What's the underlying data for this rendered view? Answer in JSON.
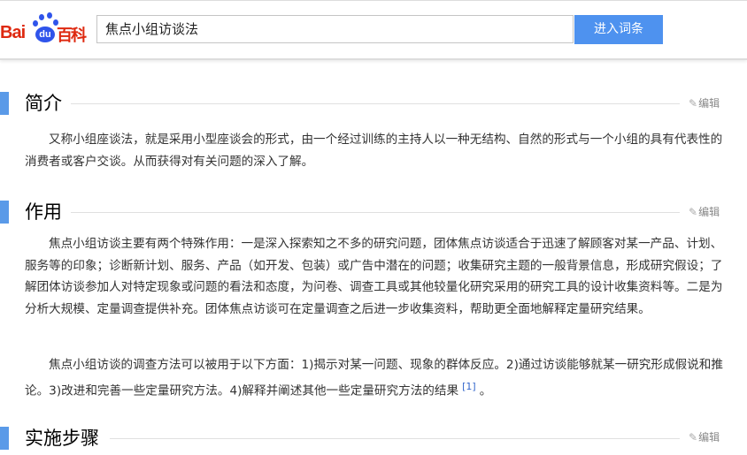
{
  "header": {
    "logo_text": "Baidu百科",
    "search_value": "焦点小组访谈法",
    "search_button": "进入词条"
  },
  "sections": [
    {
      "title": "简介",
      "edit": "编辑",
      "paragraphs": [
        "又称小组座谈法，就是采用小型座谈会的形式，由一个经过训练的主持人以一种无结构、自然的形式与一个小组的具有代表性的消费者或客户交谈。从而获得对有关问题的深入了解。"
      ]
    },
    {
      "title": "作用",
      "edit": "编辑",
      "paragraphs": [
        "焦点小组访谈主要有两个特殊作用：一是深入探索知之不多的研究问题，团体焦点访谈适合于迅速了解顾客对某一产品、计划、服务等的印象；诊断新计划、服务、产品（如开发、包装）或广告中潜在的问题；收集研究主题的一般背景信息，形成研究假设；了解团体访谈参加人对特定现象或问题的看法和态度，为问卷、调查工具或其他较量化研究采用的研究工具的设计收集资料等。二是为分析大规模、定量调查提供补充。团体焦点访谈可在定量调查之后进一步收集资料，帮助更全面地解释定量研究结果。",
        "焦点小组访谈的调查方法可以被用于以下方面：1)揭示对某一问题、现象的群体反应。2)通过访谈能够就某一研究形成假说和推论。3)改进和完善一些定量研究方法。4)解释并阐述其他一些定量研究方法的结果"
      ],
      "citation": "[1]",
      "tail": "。"
    },
    {
      "title": "实施步骤",
      "edit": "编辑"
    }
  ]
}
